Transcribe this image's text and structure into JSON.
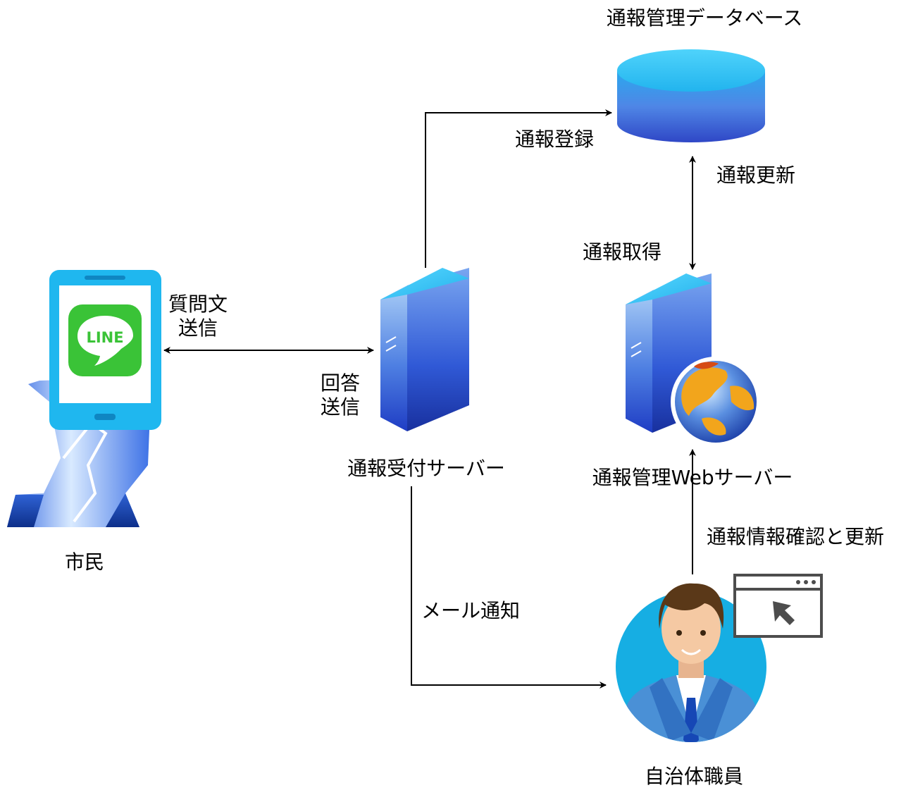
{
  "nodes": {
    "database": {
      "label": "通報管理データベース",
      "icon": "database-cylinder-icon"
    },
    "reception_server": {
      "label": "通報受付サーバー",
      "icon": "server-tower-icon"
    },
    "web_server": {
      "label": "通報管理Webサーバー",
      "icon": "web-server-globe-icon"
    },
    "citizen": {
      "label": "市民",
      "icon": "person-with-smartphone-icon",
      "app_logo_text": "LINE"
    },
    "staff": {
      "label": "自治体職員",
      "icon": "staff-avatar-icon"
    }
  },
  "edges": {
    "question_send": {
      "line1": "質問文",
      "line2": "送信"
    },
    "answer_send": {
      "line1": "回答",
      "line2": "送信"
    },
    "register": "通報登録",
    "update": "通報更新",
    "fetch": "通報取得",
    "mail_notify": "メール通知",
    "check_update": "通報情報確認と更新"
  },
  "colors": {
    "line_green": "#3ac337",
    "phone_blue": "#1fb7ef",
    "server_blue": "#2c55c8",
    "avatar_bg": "#16aee3"
  }
}
